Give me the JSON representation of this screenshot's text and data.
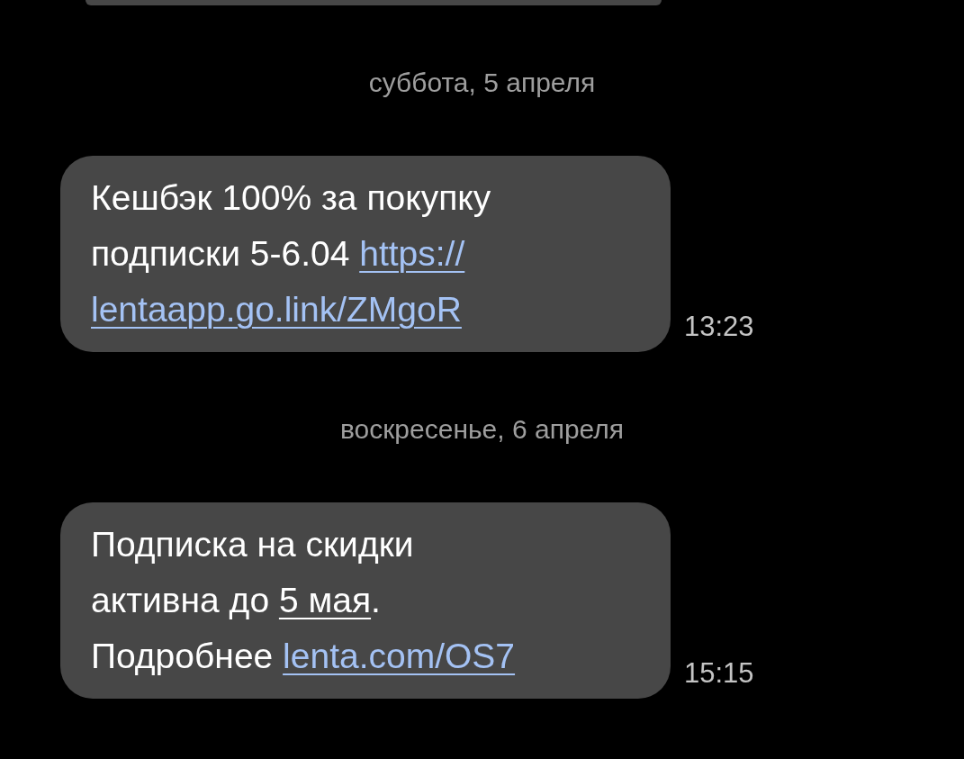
{
  "thread": [
    {
      "kind": "stub"
    },
    {
      "kind": "date",
      "text": "суббота, 5 апреля"
    },
    {
      "kind": "message",
      "time": "13:23",
      "lines": [
        [
          {
            "kind": "plain",
            "text": "Кешбэк 100% за покупку"
          }
        ],
        [
          {
            "kind": "plain",
            "text": "подписки 5-6.04 "
          },
          {
            "kind": "link",
            "text": "https://"
          }
        ],
        [
          {
            "kind": "link",
            "text": "lentaapp.go.link/ZMgoR"
          }
        ]
      ]
    },
    {
      "kind": "date",
      "text": "воскресенье, 6 апреля"
    },
    {
      "kind": "message",
      "time": "15:15",
      "lines": [
        [
          {
            "kind": "plain",
            "text": "Подписка на скидки"
          }
        ],
        [
          {
            "kind": "plain",
            "text": "активна до "
          },
          {
            "kind": "date",
            "text": "5 мая"
          },
          {
            "kind": "plain",
            "text": "."
          }
        ],
        [
          {
            "kind": "plain",
            "text": "Подробнее "
          },
          {
            "kind": "link",
            "text": "lenta.com/OS7"
          }
        ]
      ]
    }
  ]
}
